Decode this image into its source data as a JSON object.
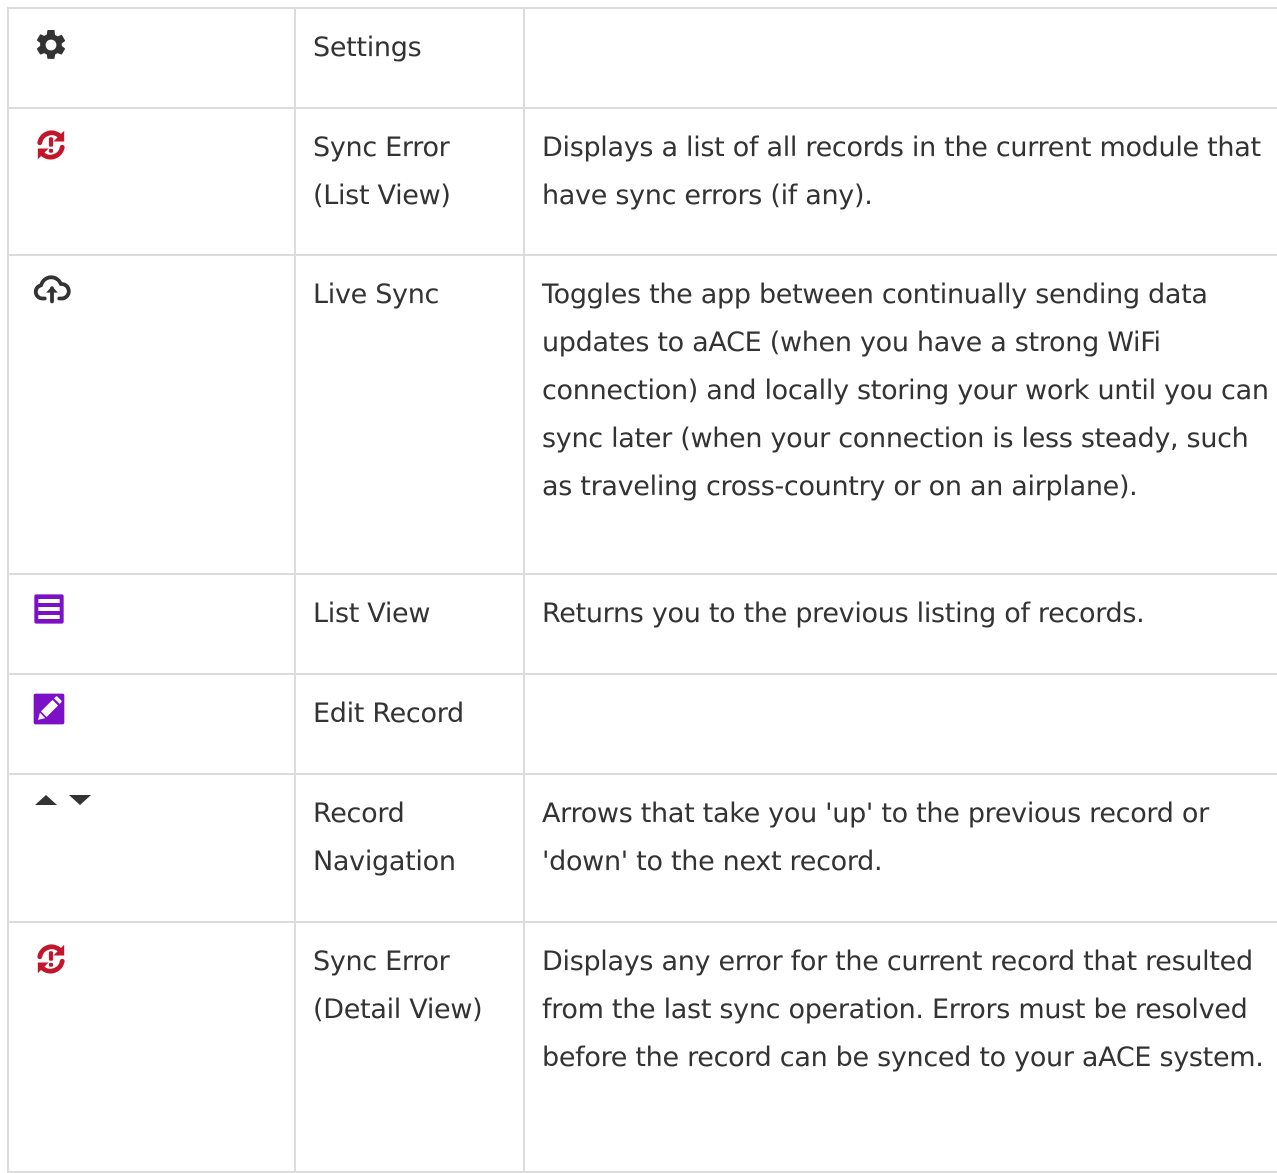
{
  "rows": [
    {
      "icon": "gear-icon",
      "name": "Settings",
      "description": ""
    },
    {
      "icon": "sync-error-icon",
      "name": "Sync Error (List View)",
      "description": "Displays a list of all records in the current module that have sync errors (if any)."
    },
    {
      "icon": "cloud-upload-icon",
      "name": "Live Sync",
      "description": "Toggles the app between continually sending data updates to aACE (when you have a strong WiFi connection) and locally storing your work until you can sync later (when your connection is less steady, such as traveling cross-country or on an airplane)."
    },
    {
      "icon": "list-view-icon",
      "name": "List View",
      "description": "Returns you to the previous listing of records."
    },
    {
      "icon": "edit-record-icon",
      "name": "Edit Record",
      "description": ""
    },
    {
      "icon": "up-down-arrows-icon",
      "name": "Record Navigation",
      "description": "Arrows that take you 'up' to the previous record or 'down' to the next record."
    },
    {
      "icon": "sync-error-icon",
      "name": "Sync Error (Detail View)",
      "description": "Displays any error for the current record that resulted from the last sync operation. Errors must be resolved before the record can be synced to your aACE system."
    }
  ],
  "colors": {
    "gear": "#333333",
    "sync_error": "#c4162a",
    "cloud": "#333333",
    "purple": "#7b10c7",
    "arrows": "#333333",
    "border": "#dcdcdc"
  }
}
